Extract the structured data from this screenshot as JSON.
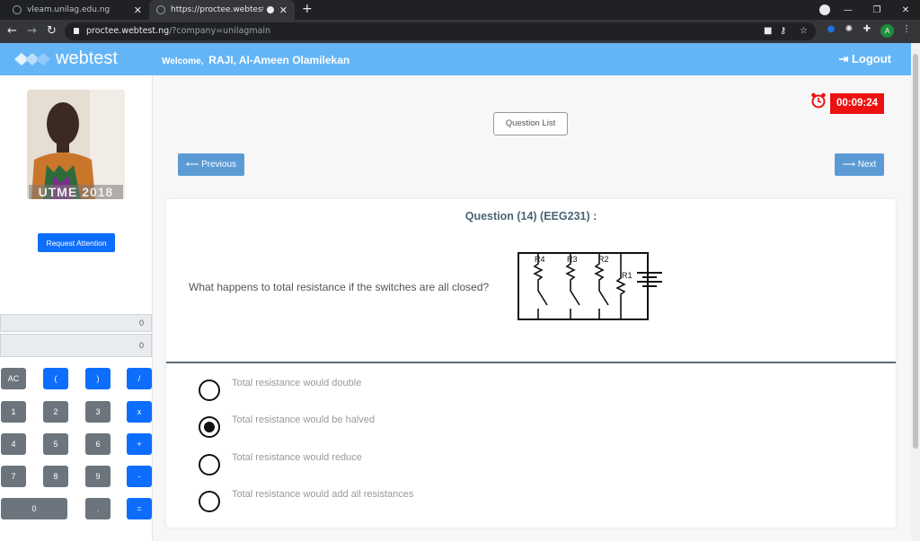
{
  "browser": {
    "tabs": [
      {
        "title": "vleam.unilag.edu.ng"
      },
      {
        "title": "https://proctee.webtest.ng/"
      }
    ],
    "new_tab_glyph": "+",
    "url_host": "proctee.webtest.ng",
    "url_query": "/?company=unilagmain",
    "profile_initial": "A"
  },
  "header": {
    "logo_text": "webtest",
    "welcome_label": "Welcome,",
    "user_name": "RAJI, Al-Ameen Olamilekan",
    "logout_label": "Logout"
  },
  "sidebar": {
    "photo_caption": "UTME 2018",
    "attention_label": "Request Attention",
    "calculator": {
      "display_expression": "0",
      "display_result": "0",
      "keys": [
        {
          "label": "AC",
          "style": "gray"
        },
        {
          "label": "(",
          "style": "blue"
        },
        {
          "label": ")",
          "style": "blue"
        },
        {
          "label": "/",
          "style": "blue"
        },
        {
          "label": "1",
          "style": "gray"
        },
        {
          "label": "2",
          "style": "gray"
        },
        {
          "label": "3",
          "style": "gray"
        },
        {
          "label": "x",
          "style": "blue"
        },
        {
          "label": "4",
          "style": "gray"
        },
        {
          "label": "5",
          "style": "gray"
        },
        {
          "label": "6",
          "style": "gray"
        },
        {
          "label": "+",
          "style": "blue"
        },
        {
          "label": "7",
          "style": "gray"
        },
        {
          "label": "8",
          "style": "gray"
        },
        {
          "label": "9",
          "style": "gray"
        },
        {
          "label": "-",
          "style": "blue"
        },
        {
          "label": "0",
          "style": "gray"
        },
        {
          "label": ".",
          "style": "gray"
        },
        {
          "label": "=",
          "style": "blue"
        }
      ]
    }
  },
  "exam": {
    "timer": "00:09:24",
    "question_list_label": "Question List",
    "previous_label": "⟵ Previous",
    "next_label": "⟶ Next",
    "question_heading": "Question (14) (EEG231) :",
    "question_text": "What happens to total resistance if the switches are all closed?",
    "circuit_labels": [
      "R4",
      "R3",
      "R2",
      "R1"
    ],
    "options": [
      {
        "label": "Total resistance would double",
        "selected": false
      },
      {
        "label": "Total resistance would be halved",
        "selected": true
      },
      {
        "label": "Total resistance would reduce",
        "selected": false
      },
      {
        "label": "Total resistance would add all resistances",
        "selected": false
      }
    ]
  },
  "colors": {
    "header_bg": "#64b5f6",
    "timer_bg": "#ee1111",
    "nav_button_bg": "#5b9bd5",
    "primary_button": "#0d6efd",
    "calc_gray": "#6c757d"
  }
}
